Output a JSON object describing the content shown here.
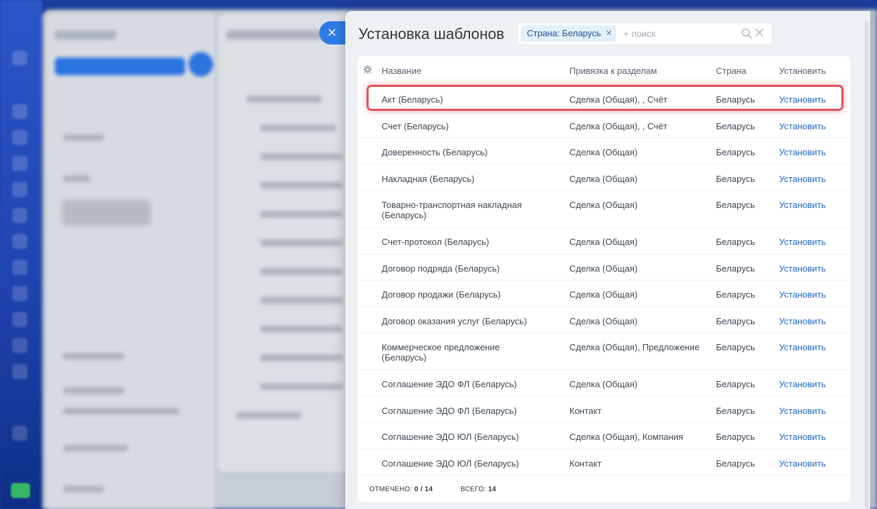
{
  "panel": {
    "title": "Установка шаблонов",
    "close_icon": "close-icon",
    "filter_tag": "Страна: Беларусь",
    "search_placeholder": "+ поиск"
  },
  "table": {
    "headers": {
      "name": "Название",
      "sections": "Привязка к разделам",
      "country": "Страна",
      "install": "Установить"
    },
    "rows": [
      {
        "name": "Акт (Беларусь)",
        "sections": "Сделка (Общая), , Счёт",
        "country": "Беларусь",
        "install": "Установить"
      },
      {
        "name": "Счет (Беларусь)",
        "sections": "Сделка (Общая), , Счёт",
        "country": "Беларусь",
        "install": "Установить"
      },
      {
        "name": "Доверенность (Беларусь)",
        "sections": "Сделка (Общая)",
        "country": "Беларусь",
        "install": "Установить"
      },
      {
        "name": "Накладная (Беларусь)",
        "sections": "Сделка (Общая)",
        "country": "Беларусь",
        "install": "Установить"
      },
      {
        "name": "Товарно-транспортная накладная (Беларусь)",
        "sections": "Сделка (Общая)",
        "country": "Беларусь",
        "install": "Установить"
      },
      {
        "name": "Счет-протокол (Беларусь)",
        "sections": "Сделка (Общая)",
        "country": "Беларусь",
        "install": "Установить"
      },
      {
        "name": "Договор подряда (Беларусь)",
        "sections": "Сделка (Общая)",
        "country": "Беларусь",
        "install": "Установить"
      },
      {
        "name": "Договор продажи (Беларусь)",
        "sections": "Сделка (Общая)",
        "country": "Беларусь",
        "install": "Установить"
      },
      {
        "name": "Договор оказания услуг (Беларусь)",
        "sections": "Сделка (Общая)",
        "country": "Беларусь",
        "install": "Установить"
      },
      {
        "name": "Коммерческое предложение (Беларусь)",
        "sections": "Сделка (Общая), Предложение",
        "country": "Беларусь",
        "install": "Установить"
      },
      {
        "name": "Соглашение ЭДО ФЛ (Беларусь)",
        "sections": "Сделка (Общая)",
        "country": "Беларусь",
        "install": "Установить"
      },
      {
        "name": "Соглашение ЭДО ФЛ (Беларусь)",
        "sections": "Контакт",
        "country": "Беларусь",
        "install": "Установить"
      },
      {
        "name": "Соглашение ЭДО ЮЛ (Беларусь)",
        "sections": "Сделка (Общая), Компания",
        "country": "Беларусь",
        "install": "Установить"
      },
      {
        "name": "Соглашение ЭДО ЮЛ (Беларусь)",
        "sections": "Контакт",
        "country": "Беларусь",
        "install": "Установить"
      }
    ],
    "footer": {
      "checked_label": "ОТМЕЧЕНО:",
      "checked_value": "0 / 14",
      "total_label": "ВСЕГО:",
      "total_value": "14"
    }
  },
  "colors": {
    "accent": "#2f7be5",
    "link": "#1f66c2",
    "highlight": "#e0525b"
  }
}
